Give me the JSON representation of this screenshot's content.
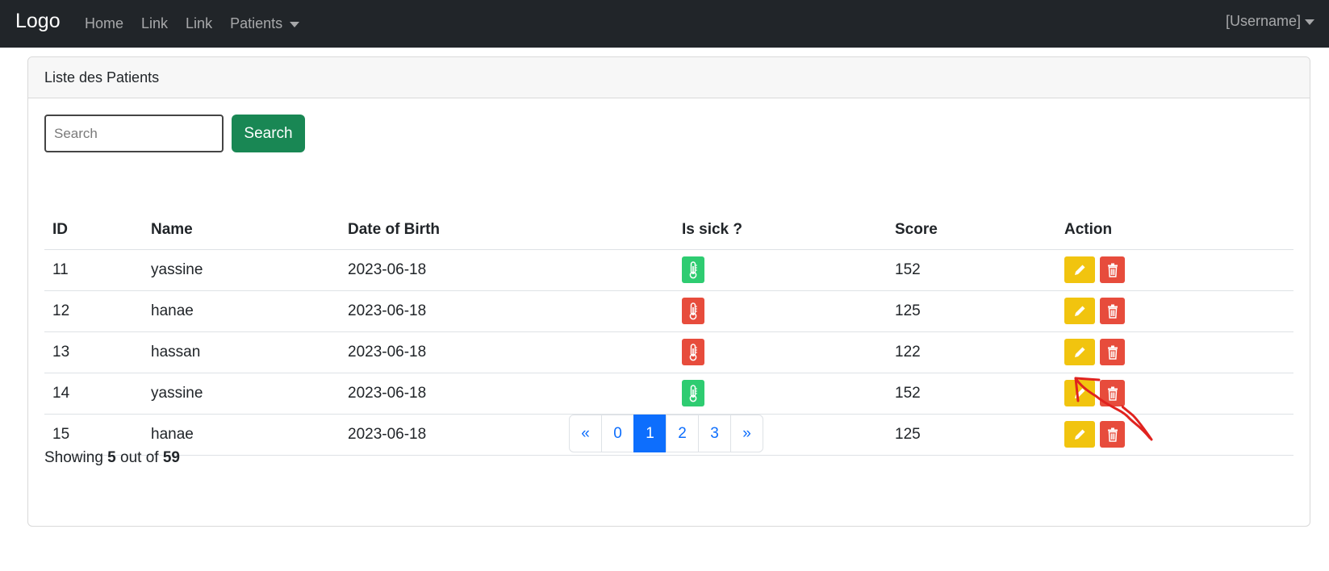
{
  "navbar": {
    "brand": "Logo",
    "links": [
      "Home",
      "Link",
      "Link"
    ],
    "dropdown_label": "Patients",
    "user_label": "[Username]"
  },
  "card": {
    "title": "Liste des Patients",
    "search_placeholder": "Search",
    "search_button": "Search"
  },
  "table": {
    "headers": [
      "ID",
      "Name",
      "Date of Birth",
      "Is sick ?",
      "Score",
      "Action"
    ],
    "rows": [
      {
        "id": "11",
        "name": "yassine",
        "dob": "2023-06-18",
        "sick": false,
        "score": "152"
      },
      {
        "id": "12",
        "name": "hanae",
        "dob": "2023-06-18",
        "sick": true,
        "score": "125"
      },
      {
        "id": "13",
        "name": "hassan",
        "dob": "2023-06-18",
        "sick": true,
        "score": "122"
      },
      {
        "id": "14",
        "name": "yassine",
        "dob": "2023-06-18",
        "sick": false,
        "score": "152"
      },
      {
        "id": "15",
        "name": "hanae",
        "dob": "2023-06-18",
        "sick": true,
        "score": "125"
      }
    ]
  },
  "pagination": {
    "prev": "«",
    "pages": [
      "0",
      "1",
      "2",
      "3"
    ],
    "active_page": "1",
    "next": "»"
  },
  "footer": {
    "showing_prefix": "Showing",
    "shown_count": "5",
    "out_of_label": "out of",
    "total_count": "59"
  },
  "icons": {
    "sick_status": "thermometer-icon",
    "edit": "pencil-icon",
    "delete": "trash-icon"
  },
  "colors": {
    "navbar": "#212529",
    "search_button": "#198754",
    "not_sick": "#2ecc71",
    "sick": "#e74c3c",
    "edit": "#f1c40f",
    "delete": "#e74c3c",
    "page_active": "#0d6efd",
    "annotation": "#e0231f"
  }
}
